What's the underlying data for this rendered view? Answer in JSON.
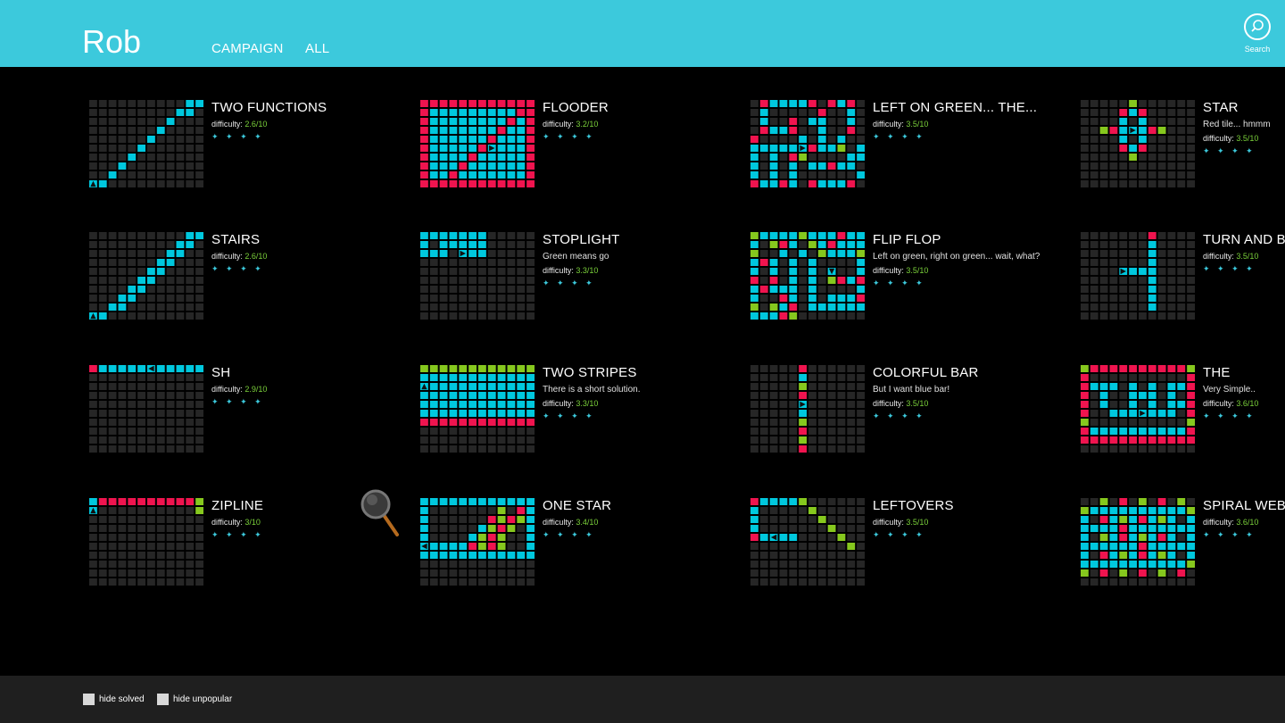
{
  "header": {
    "title": "Rob",
    "tabs": [
      {
        "label": "CAMPAIGN"
      },
      {
        "label": "ALL"
      }
    ],
    "search_label": "Search",
    "color": "#3cc9dc"
  },
  "colors": {
    "cyan": "#00c8de",
    "red": "#f0144f",
    "green": "#86c81e",
    "empty": "#262626",
    "accent": "#3cc9dc"
  },
  "puzzles": [
    {
      "name": "TWO FUNCTIONS",
      "description": "",
      "difficulty_label": "difficulty:",
      "difficulty": "2.6/10",
      "stars": "✦ ✦ ✦ ✦",
      "map": [
        "..........CC",
        ".........CC.",
        "........C...",
        ".......C....",
        "......C.....",
        ".....C......",
        "....C.......",
        "...C........",
        "..C.........",
        "^C.........."
      ]
    },
    {
      "name": "FLOODER",
      "description": "",
      "difficulty_label": "difficulty:",
      "difficulty": "3.2/10",
      "stars": "✦ ✦ ✦ ✦",
      "map": [
        "RRRRRRRRRRRR",
        "RCCCCCCCCCRR",
        "RCCCCCCCCRCR",
        "RCCCCCCCRCCR",
        "RCCCCCCRCCCR",
        "RCCCCCR>CCCR",
        "RCCCCRCCCCCR",
        "RCCCRCCCCCCR",
        "RCCRCCCCCCCR",
        "RRRRRRRRRRRR"
      ]
    },
    {
      "name": "LEFT ON GREEN... THE...",
      "description": "",
      "difficulty_label": "difficulty:",
      "difficulty": "3.5/10",
      "stars": "✦ ✦ ✦ ✦",
      "map": [
        ".RCCCCR.RCR.",
        ".C.....R..C.",
        ".C..R.CC..C.",
        ".RCCR..C..R.",
        "R....C.C.C..",
        "CCCCC>RCCG.C",
        "C.C.RG....CC",
        "C.C.C.CCRCC.",
        "C.C.C......C",
        "RCCRC.RCCCR."
      ]
    },
    {
      "name": "STAR",
      "description": "Red tile... hmmm",
      "difficulty_label": "difficulty:",
      "difficulty": "3.5/10",
      "stars": "✦ ✦ ✦ ✦",
      "map": [
        ".....G......",
        "....RCR.....",
        "....C.C.....",
        "..GRC>CRG...",
        "....C.C.....",
        "....RCR.....",
        ".....G......",
        "............",
        "............",
        "............"
      ],
      "map_scale": 2
    },
    {
      "name": "STAIRS",
      "description": "",
      "difficulty_label": "difficulty:",
      "difficulty": "2.6/10",
      "stars": "✦ ✦ ✦ ✦",
      "map": [
        "..........CC",
        ".........CC.",
        "........CC..",
        ".......CC...",
        "......CC....",
        ".....CC.....",
        "....CC......",
        "...CC.......",
        "..CC........",
        "^C.........."
      ]
    },
    {
      "name": "STOPLIGHT",
      "description": "Green means go",
      "difficulty_label": "difficulty:",
      "difficulty": "3.3/10",
      "stars": "✦ ✦ ✦ ✦",
      "map": [
        "CCCCCCC",
        "C.CCCCC",
        "CCC.>CC",
        "......."
      ],
      "map_scale": 1,
      "map_override": "stoplight"
    },
    {
      "name": "FLIP FLOP",
      "description": "Left on green, right on green... wait, what?",
      "difficulty_label": "difficulty:",
      "difficulty": "3.5/10",
      "stars": "✦ ✦ ✦ ✦",
      "map": [
        "GCCCCGCCCRCC",
        "C.GRC.GCRCCC",
        "G..C.C.GCCCG",
        "CRC.C.C....C",
        "C.C.C.C.v..C",
        "R.R.C.C.GRCR",
        "CRCCC.C....C",
        "C..RC.C.CCCR",
        "G.GCR.CCCCCC",
        "CCCRG........"
      ]
    },
    {
      "name": "TURN AND BA",
      "description": "",
      "difficulty_label": "difficulty:",
      "difficulty": "3.5/10",
      "stars": "✦ ✦ ✦ ✦",
      "map": [
        ".......R....",
        ".......C....",
        ".......C....",
        ".......C....",
        "....>CCC....",
        ".......C....",
        ".......C....",
        ".......C....",
        ".......C....",
        "............"
      ]
    },
    {
      "name": "SH",
      "description": "",
      "difficulty_label": "difficulty:",
      "difficulty": "2.9/10",
      "stars": "✦ ✦ ✦ ✦",
      "map": [
        "RCCCCC<CCCCC",
        "............",
        "............",
        "............",
        "............",
        "............",
        "............",
        "............",
        "............",
        "............"
      ]
    },
    {
      "name": "TWO STRIPES",
      "description": "There is a short solution.",
      "difficulty_label": "difficulty:",
      "difficulty": "3.3/10",
      "stars": "✦ ✦ ✦ ✦",
      "map": [
        "GGGGGGGGGGGG",
        "CCCCCCCCCCCC",
        "^CCCCCCCCCCC",
        "CCCCCCCCCCCC",
        "CCCCCCCCCCCC",
        "CCCCCCCCCCCC",
        "RRRRRRRRRRRR",
        "............",
        "............",
        "............"
      ]
    },
    {
      "name": "COLORFUL BAR",
      "description": "But I want blue bar!",
      "difficulty_label": "difficulty:",
      "difficulty": "3.5/10",
      "stars": "✦ ✦ ✦ ✦",
      "map": [
        ".....R......",
        ".....C......",
        ".....G......",
        ".....R......",
        ".....>......",
        ".....C......",
        ".....G......",
        ".....R......",
        ".....G......",
        ".....R......"
      ]
    },
    {
      "name": "THE",
      "description": "Very Simple..",
      "difficulty_label": "difficulty:",
      "difficulty": "3.6/10",
      "stars": "✦ ✦ ✦ ✦",
      "map": [
        "GRRRRRRRRRRG",
        "R..........R",
        "RCCC.C.C.CCR",
        "R.C..CCC.C.R",
        "R.C..C.C.CCR",
        "R..CCC>CCC.R",
        "G..........G",
        "RCCCCCCCCCCR",
        "RRRRRRRRRRRR",
        "............"
      ]
    },
    {
      "name": "ZIPLINE",
      "description": "",
      "difficulty_label": "difficulty:",
      "difficulty": "3/10",
      "stars": "✦ ✦ ✦ ✦",
      "map": [
        "CRRRRRRRRRRG",
        "^..........G",
        "............",
        "............",
        "............",
        "............",
        "............",
        "............",
        "............",
        "............"
      ]
    },
    {
      "name": "ONE STAR",
      "description": "",
      "difficulty_label": "difficulty:",
      "difficulty": "3.4/10",
      "stars": "✦ ✦ ✦ ✦",
      "map": [
        "CCCCCCCCCCCC",
        "C.......G.RC",
        "C......RGRGC",
        "C.....CGRG.C",
        "C....CGRG..C",
        "<CCCCRGRG..C",
        "CCCCCCCCCCCC",
        "............",
        "............",
        "............"
      ]
    },
    {
      "name": "LEFTOVERS",
      "description": "",
      "difficulty_label": "difficulty:",
      "difficulty": "3.5/10",
      "stars": "✦ ✦ ✦ ✦",
      "map": [
        "RCCCCG......",
        "C.....G.....",
        "C......G....",
        "C.......G...",
        "RC<CC....G..",
        "..........G.",
        "............",
        "............",
        "............",
        "............"
      ],
      "map_scale": 1
    },
    {
      "name": "SPIRAL WEB",
      "description": "",
      "difficulty_label": "difficulty:",
      "difficulty": "3.6/10",
      "stars": "✦ ✦ ✦ ✦",
      "map": [
        "..G.R.G.R.G.",
        "GCCCCCCCCCCG",
        "C.RCGCRCGC.C",
        "CCCCRCCCCCCC",
        "C.GCRCGCRC.C",
        "CCCCCCRCCCCC",
        "C.RCGCRCGC.C",
        "CCCCCCCCCCCG",
        "G.R.G.R.G.R.",
        "............"
      ]
    }
  ],
  "bottom_bar": {
    "hide_solved_label": "hide solved",
    "hide_unpopular_label": "hide unpopular"
  }
}
